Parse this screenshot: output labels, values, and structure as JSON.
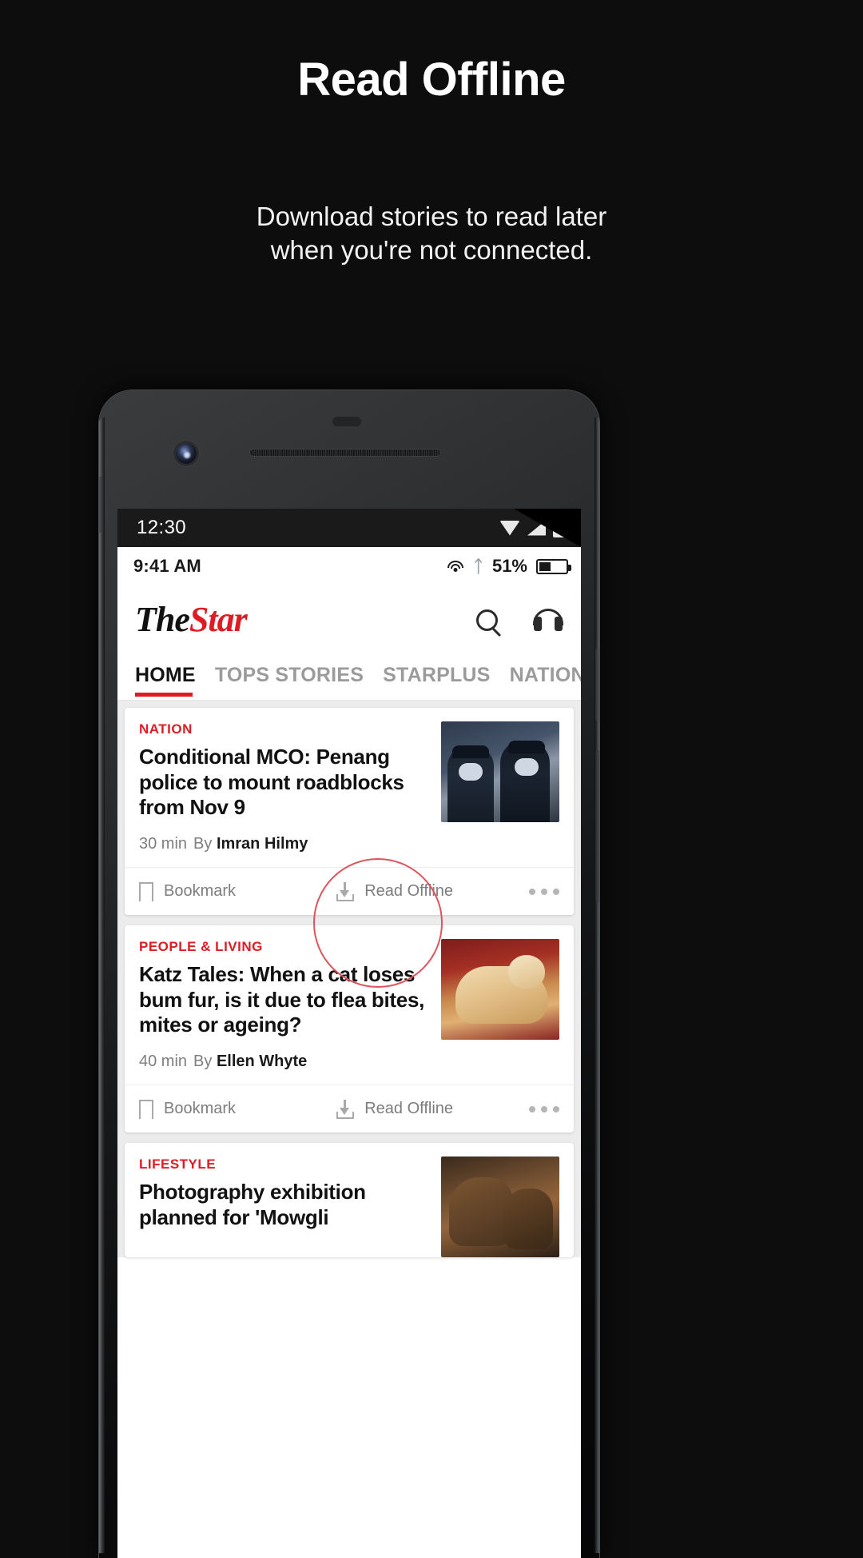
{
  "promo": {
    "title": "Read Offline",
    "subtitle_line1": "Download stories to read later",
    "subtitle_line2": "when you're not connected.",
    "accent_color": "#e01b24",
    "background_color": "#0d0d0d"
  },
  "system_status_bar": {
    "time": "12:30",
    "icons": [
      "wifi-icon",
      "signal-icon",
      "battery-icon"
    ]
  },
  "app_status_bar": {
    "time": "9:41 AM",
    "battery_percent": "51%",
    "icons": [
      "wifi-icon",
      "bluetooth-icon",
      "battery-icon"
    ]
  },
  "header": {
    "logo_the": "The",
    "logo_star": "Star",
    "search_icon": "search-icon",
    "audio_icon": "headphones-icon"
  },
  "tabs": [
    {
      "label": "HOME",
      "active": true
    },
    {
      "label": "TOPS STORIES",
      "active": false
    },
    {
      "label": "STARPLUS",
      "active": false
    },
    {
      "label": "NATION",
      "active": false
    }
  ],
  "action_labels": {
    "bookmark": "Bookmark",
    "read_offline": "Read Offline",
    "more": "more-options"
  },
  "articles": [
    {
      "category": "NATION",
      "headline": "Conditional MCO: Penang police to mount roadblocks from Nov 9",
      "time_ago": "30 min",
      "by_label": "By",
      "author": "Imran Hilmy",
      "thumbnail": "police-officers-photo"
    },
    {
      "category": "PEOPLE & LIVING",
      "headline": "Katz Tales: When a cat loses bum fur, is it due to flea bites, mites or ageing?",
      "time_ago": "40 min",
      "by_label": "By",
      "author": "Ellen Whyte",
      "thumbnail": "ginger-cat-photo"
    },
    {
      "category": "LIFESTYLE",
      "headline": "Photography exhibition planned for 'Mowgli",
      "time_ago": "",
      "by_label": "",
      "author": "",
      "thumbnail": "buffalo-photo"
    }
  ],
  "annotation": {
    "target": "read-offline-button",
    "color": "#e0535c"
  }
}
